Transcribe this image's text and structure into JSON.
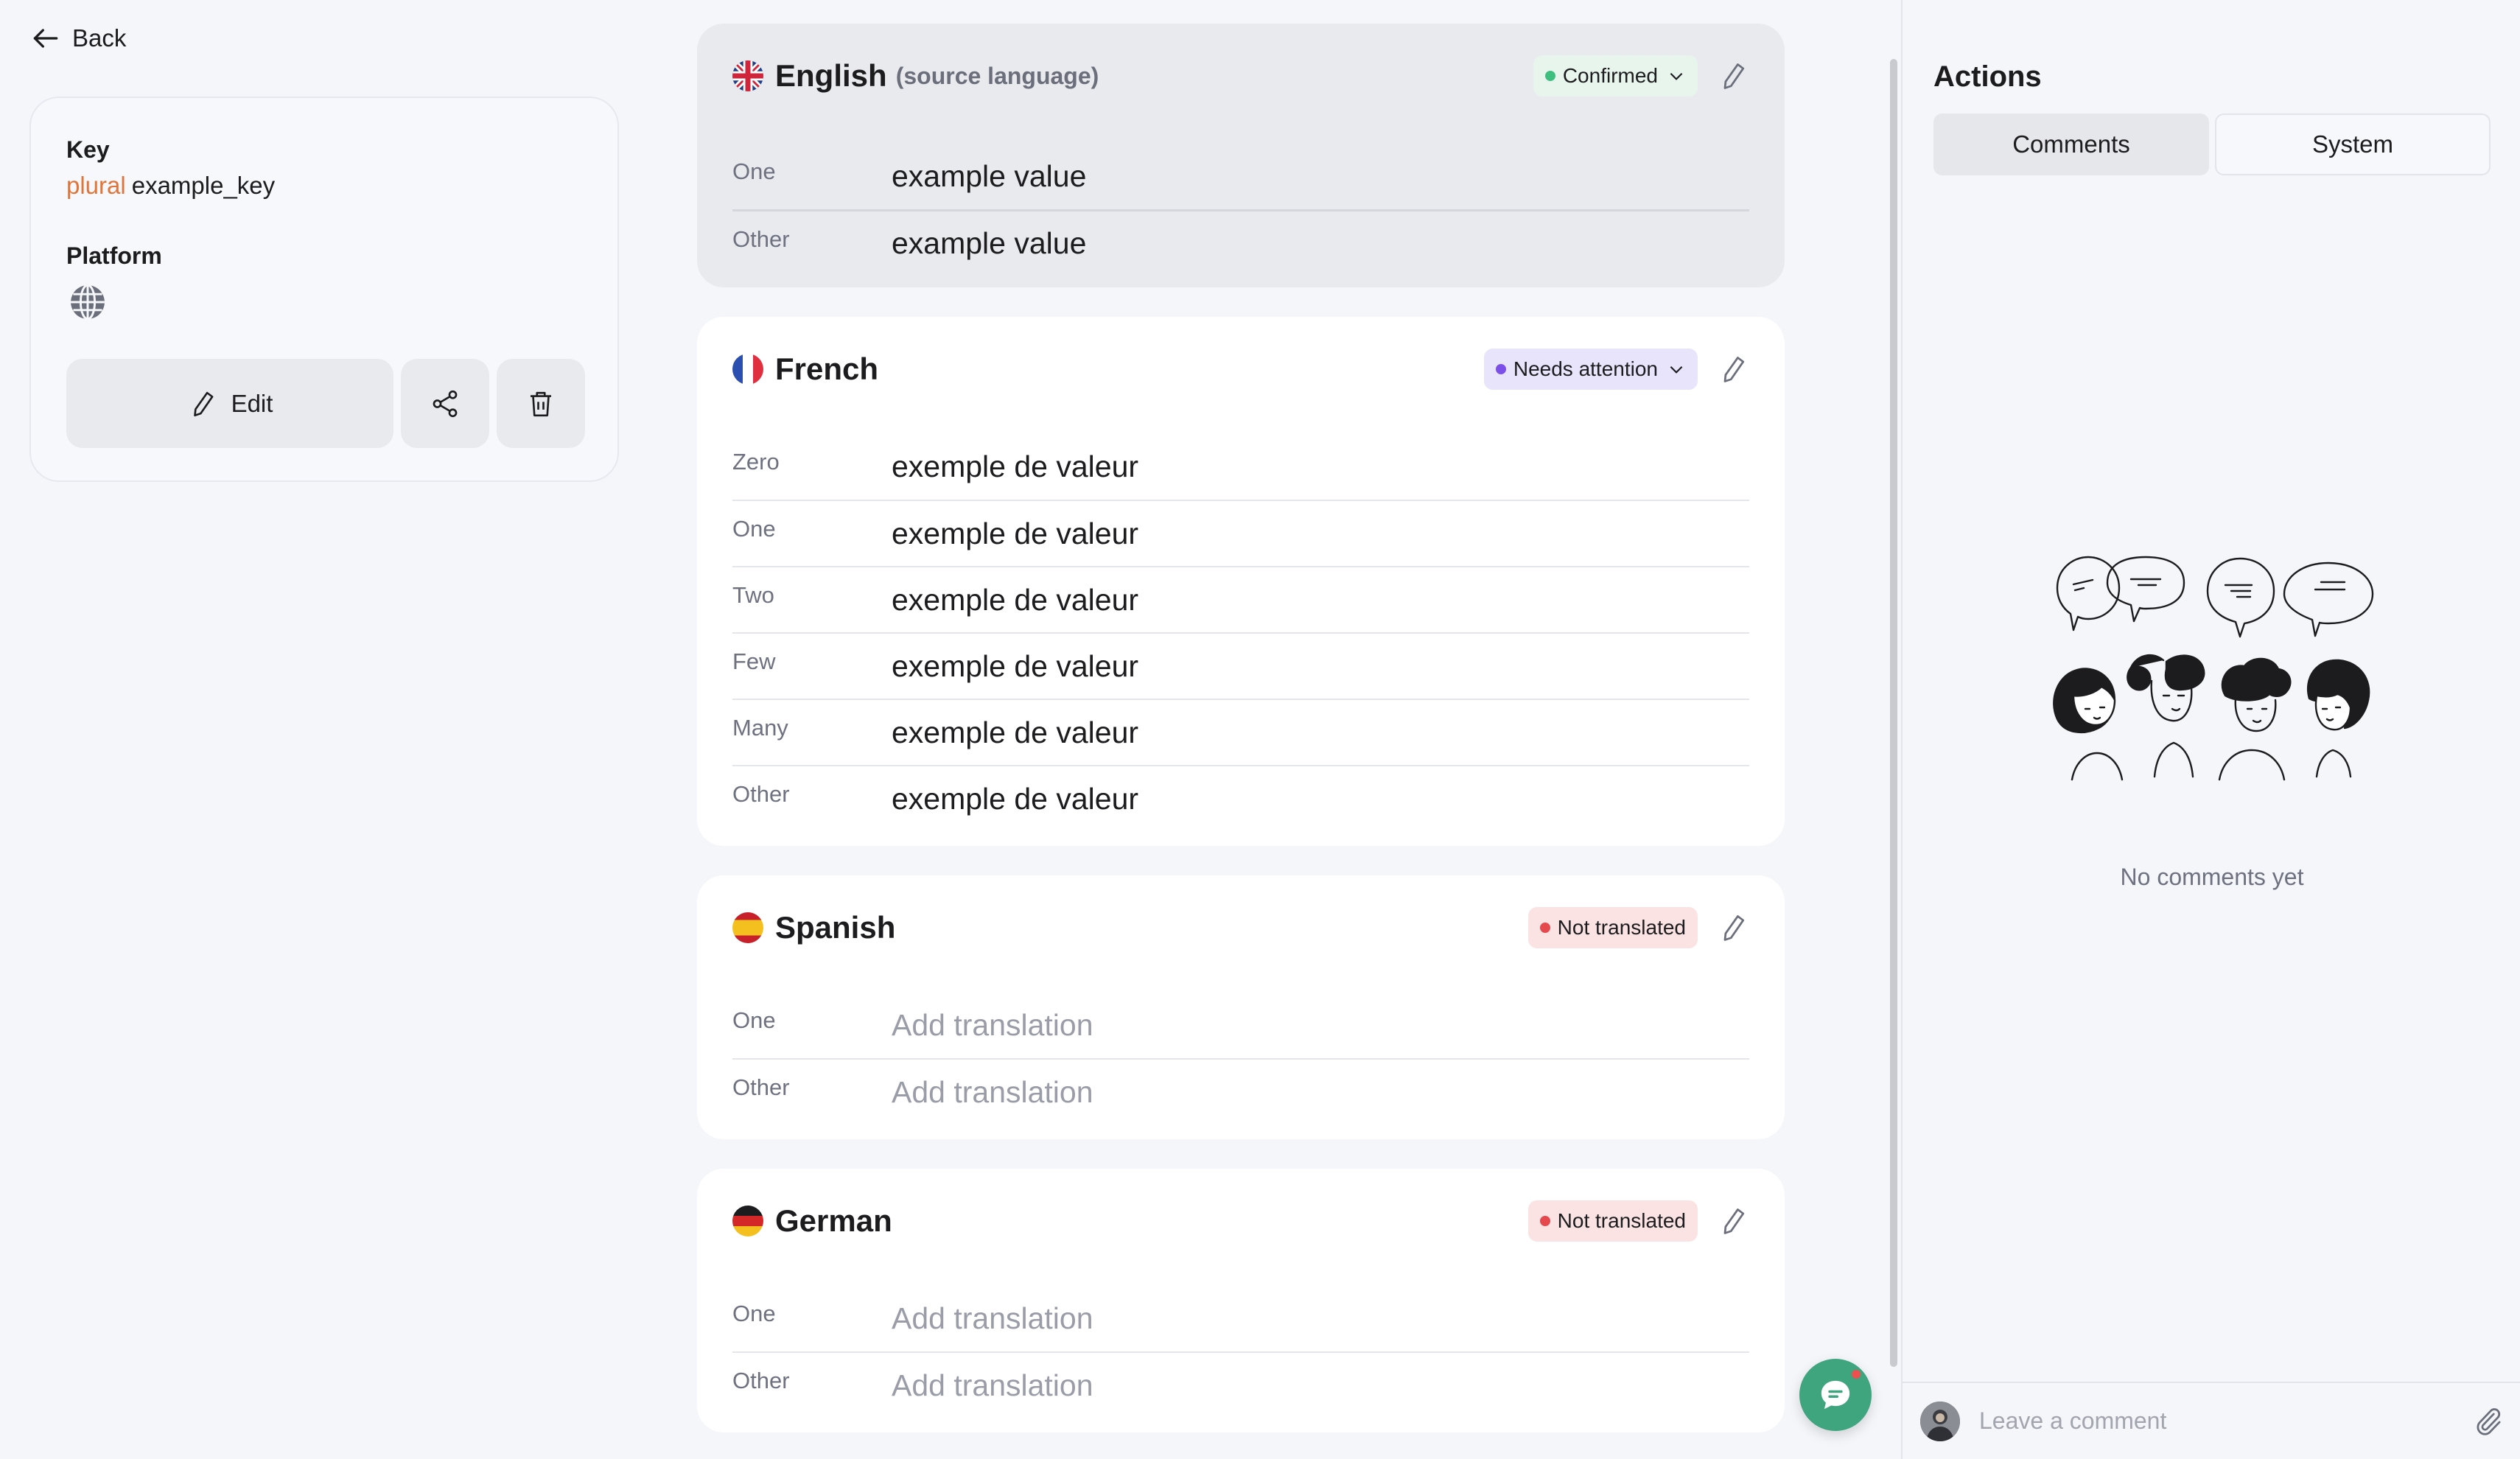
{
  "nav": {
    "back_label": "Back",
    "back_icon": "arrow-left-icon"
  },
  "key_card": {
    "key_heading": "Key",
    "key_type": "plural",
    "key_name": "example_key",
    "platform_heading": "Platform",
    "platform_icon": "globe-icon",
    "edit_label": "Edit",
    "share_icon": "share-icon",
    "delete_icon": "trash-icon"
  },
  "languages": [
    {
      "name": "English",
      "suffix": "(source language)",
      "flag": "uk-flag-icon",
      "status": {
        "label": "Confirmed",
        "color": "#3fbf7f",
        "bg": "#e8f5ec",
        "has_dropdown": true
      },
      "rows": [
        {
          "label": "One",
          "value": "example value"
        },
        {
          "label": "Other",
          "value": "example value"
        }
      ]
    },
    {
      "name": "French",
      "flag": "france-flag-icon",
      "status": {
        "label": "Needs attention",
        "color": "#7b4fe8",
        "bg": "#e8e4fb",
        "has_dropdown": true
      },
      "rows": [
        {
          "label": "Zero",
          "value": "exemple de valeur"
        },
        {
          "label": "One",
          "value": "exemple de valeur"
        },
        {
          "label": "Two",
          "value": "exemple de valeur"
        },
        {
          "label": "Few",
          "value": "exemple de valeur"
        },
        {
          "label": "Many",
          "value": "exemple de valeur"
        },
        {
          "label": "Other",
          "value": "exemple de valeur"
        }
      ]
    },
    {
      "name": "Spanish",
      "flag": "spain-flag-icon",
      "status": {
        "label": "Not translated",
        "color": "#e5484d",
        "bg": "#fbe3e3",
        "has_dropdown": false
      },
      "rows": [
        {
          "label": "One",
          "placeholder": "Add translation"
        },
        {
          "label": "Other",
          "placeholder": "Add translation"
        }
      ]
    },
    {
      "name": "German",
      "flag": "germany-flag-icon",
      "status": {
        "label": "Not translated",
        "color": "#e5484d",
        "bg": "#fbe3e3",
        "has_dropdown": false
      },
      "rows": [
        {
          "label": "One",
          "placeholder": "Add translation"
        },
        {
          "label": "Other",
          "placeholder": "Add translation"
        }
      ]
    }
  ],
  "actions_panel": {
    "title": "Actions",
    "tabs": [
      {
        "label": "Comments",
        "active": true
      },
      {
        "label": "System",
        "active": false
      }
    ],
    "empty_text": "No comments yet",
    "comment_placeholder": "Leave a comment",
    "attach_icon": "paperclip-icon"
  },
  "chat_widget": {
    "icon": "chat-bubble-icon",
    "has_notification": true
  },
  "colors": {
    "accent_orange": "#e0753a",
    "chat_green": "#3fa57f",
    "background": "#f5f6fa"
  }
}
